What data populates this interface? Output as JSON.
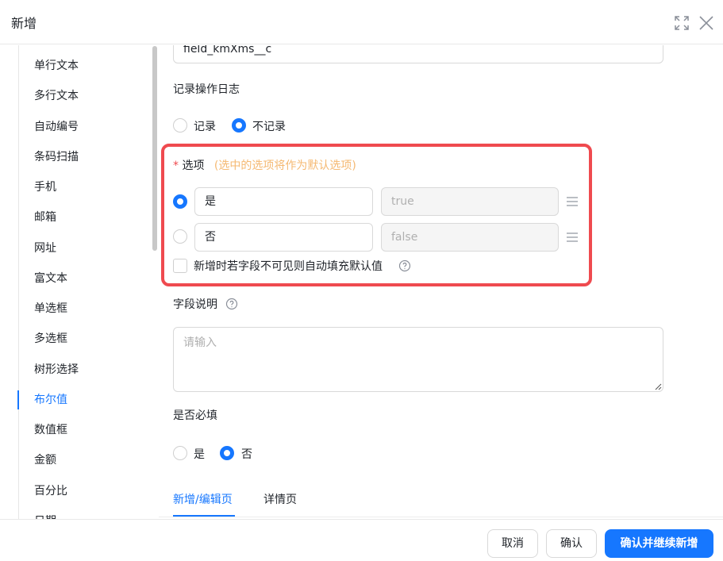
{
  "dialog": {
    "title": "新增"
  },
  "header_icons": {
    "expand": "expand-icon",
    "close": "close-icon"
  },
  "sidebar": {
    "items": [
      {
        "label": "单行文本"
      },
      {
        "label": "多行文本"
      },
      {
        "label": "自动编号"
      },
      {
        "label": "条码扫描"
      },
      {
        "label": "手机"
      },
      {
        "label": "邮箱"
      },
      {
        "label": "网址"
      },
      {
        "label": "富文本"
      },
      {
        "label": "单选框"
      },
      {
        "label": "多选框"
      },
      {
        "label": "树形选择"
      },
      {
        "label": "布尔值"
      },
      {
        "label": "数值框"
      },
      {
        "label": "金额"
      },
      {
        "label": "百分比"
      },
      {
        "label": "日期"
      }
    ],
    "active_item": "布尔值"
  },
  "form": {
    "field_api_name": {
      "value": "field_kmXms__c"
    },
    "log": {
      "label": "记录操作日志",
      "options": [
        {
          "label": "记录",
          "checked": false
        },
        {
          "label": "不记录",
          "checked": true
        }
      ]
    },
    "options_section": {
      "required_mark": "*",
      "label": "选项",
      "hint": "(选中的选项将作为默认选项)",
      "rows": [
        {
          "name": "是",
          "value": "true",
          "checked": true
        },
        {
          "name": "否",
          "value": "false",
          "checked": false
        }
      ],
      "autofill_label": "新增时若字段不可见则自动填充默认值",
      "autofill_checked": false
    },
    "description": {
      "label": "字段说明",
      "placeholder": "请输入"
    },
    "required": {
      "label": "是否必填",
      "options": [
        {
          "label": "是",
          "checked": false
        },
        {
          "label": "否",
          "checked": true
        }
      ]
    },
    "tabs": [
      {
        "label": "新增/编辑页",
        "active": true
      },
      {
        "label": "详情页",
        "active": false
      }
    ]
  },
  "footer": {
    "cancel_label": "取消",
    "confirm_label": "确认",
    "confirm_continue_label": "确认并继续新增"
  },
  "colors": {
    "accent": "#1677ff",
    "highlight_border": "#ef4a4f",
    "hint_text": "#f5b972"
  }
}
